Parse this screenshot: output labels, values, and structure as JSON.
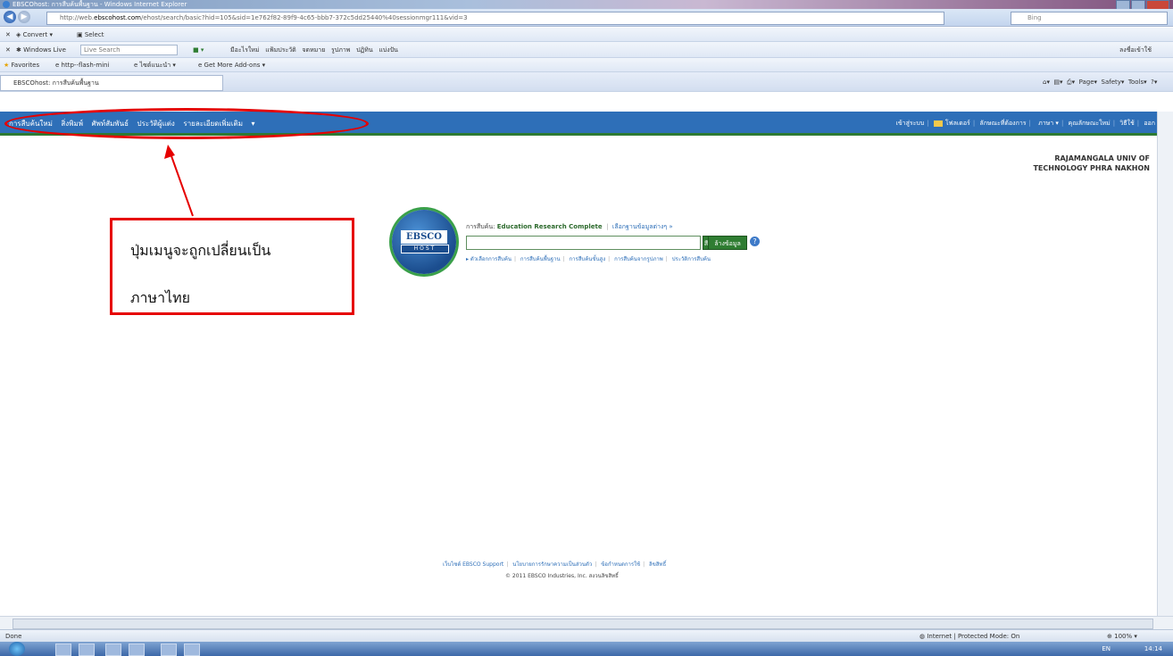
{
  "window": {
    "title": "EBSCOhost: การสืบค้นพื้นฐาน - Windows Internet Explorer",
    "address_url_prefix": "http://web.",
    "address_url_host": "ebscohost.com",
    "address_url_rest": "/ehost/search/basic?hid=105&sid=1e762f82-89f9-4c65-bbb7-372c5dd25440%40sessionmgr111&vid=3",
    "search_engine": "Bing"
  },
  "toolbar1": {
    "convert": "Convert",
    "select": "Select"
  },
  "toolbar2": {
    "windows_live": "Windows Live",
    "live_search_placeholder": "Live Search",
    "links": [
      "มีอะไรใหม่",
      "แฟ้มประวัติ",
      "จดหมาย",
      "รูปภาพ",
      "ปฏิทิน",
      "แบ่งปัน"
    ],
    "signin": "ลงชื่อเข้าใช้"
  },
  "favorites_bar": {
    "favorites": "Favorites",
    "items": [
      "http--flash-mini",
      "ไซต์แนะนำ",
      "Get More Add-ons"
    ]
  },
  "tab": {
    "label": "EBSCOhost: การสืบค้นพื้นฐาน"
  },
  "command_bar": {
    "page": "Page",
    "safety": "Safety",
    "tools": "Tools"
  },
  "ebsco_nav": {
    "left": [
      "การสืบค้นใหม่",
      "สิ่งพิมพ์",
      "ศัพท์สัมพันธ์",
      "ประวัติผู้แต่ง",
      "รายละเอียดเพิ่มเติม"
    ],
    "right": [
      "เข้าสู่ระบบ",
      "โฟลเดอร์",
      "ลักษณะที่ต้องการ",
      "ภาษา",
      "คุณลักษณะใหม่",
      "วิธีใช้",
      "ออก"
    ]
  },
  "institution": {
    "line1": "RAJAMANGALA UNIV OF",
    "line2": "TECHNOLOGY PHRA NAKHON"
  },
  "callout": {
    "line1": "ปุ่มเมนูจะถูกเปลี่ยนเป็น",
    "line2": "ภาษาไทย"
  },
  "logo": {
    "text1": "EBSCO",
    "text2": "HOST"
  },
  "search": {
    "searching_label": "การสืบค้น:",
    "database": "Education Research Complete",
    "choose_db": "เลือกฐานข้อมูลต่างๆ »",
    "search_button": "สืบค้น",
    "clear_button": "ล้างข้อมูล",
    "help": "?",
    "sublinks": [
      "▸ ตัวเลือกการสืบค้น",
      "การสืบค้นพื้นฐาน",
      "การสืบค้นขั้นสูง",
      "การสืบค้นจากรูปภาพ",
      "ประวัติการสืบค้น"
    ]
  },
  "footer": {
    "links": [
      "เว็บไซต์ EBSCO Support",
      "นโยบายการรักษาความเป็นส่วนตัว",
      "ข้อกำหนดการใช้",
      "ลิขสิทธิ์"
    ],
    "copyright": "© 2011 EBSCO Industries, Inc. สงวนลิขสิทธิ์"
  },
  "status": {
    "left": "Done",
    "zone": "Internet | Protected Mode: On",
    "zoom": "100%"
  },
  "taskbar": {
    "lang": "EN",
    "time": "14:14"
  }
}
